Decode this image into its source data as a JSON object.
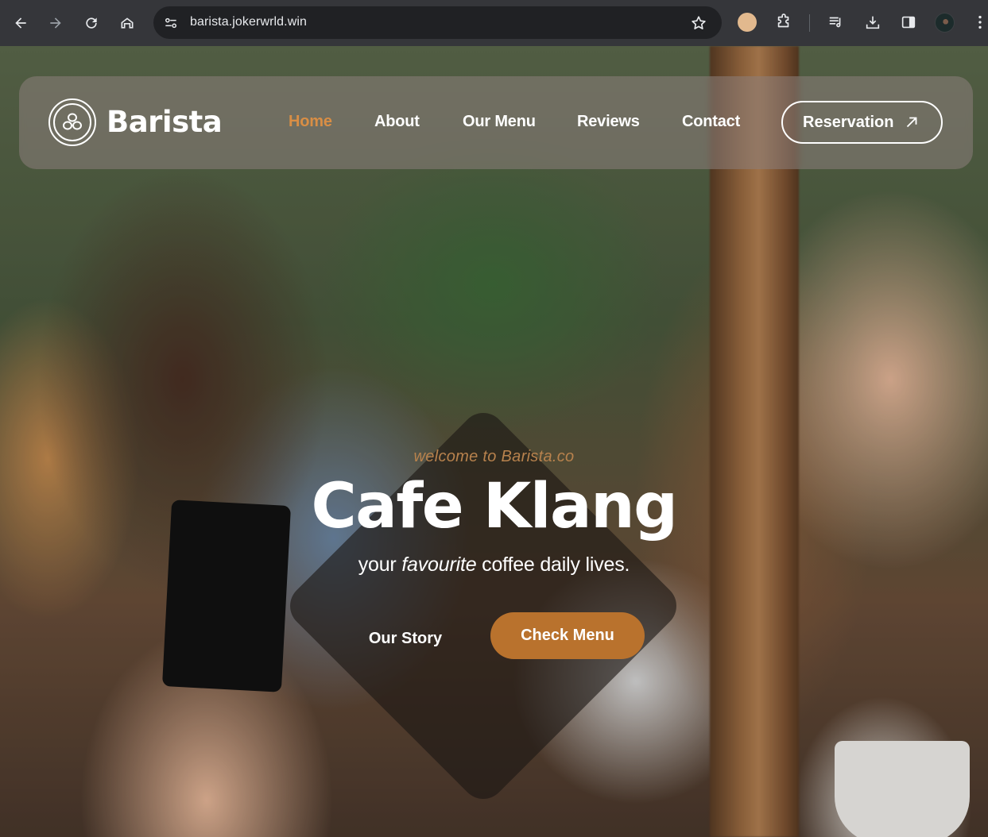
{
  "browser": {
    "url": "barista.jokerwrld.win",
    "icons": [
      "back-icon",
      "forward-icon",
      "reload-icon",
      "home-icon",
      "site-info-icon",
      "bookmark-star-icon",
      "extension-avatar-icon",
      "extensions-puzzle-icon",
      "media-controls-icon",
      "downloads-icon",
      "side-panel-icon",
      "profile-avatar-icon",
      "more-menu-icon"
    ]
  },
  "site": {
    "brand": "Barista",
    "nav": [
      {
        "label": "Home",
        "active": true
      },
      {
        "label": "About",
        "active": false
      },
      {
        "label": "Our Menu",
        "active": false
      },
      {
        "label": "Reviews",
        "active": false
      },
      {
        "label": "Contact",
        "active": false
      }
    ],
    "reservation_label": "Reservation"
  },
  "hero": {
    "eyebrow": "welcome to Barista.co",
    "title": "Cafe Klang",
    "subtitle_pre": "your ",
    "subtitle_em": "favourite",
    "subtitle_post": " coffee daily lives.",
    "secondary_cta": "Our Story",
    "primary_cta": "Check Menu"
  },
  "colors": {
    "accent": "#d98e45",
    "button": "#b9722d",
    "eyebrow": "#b8824d"
  }
}
